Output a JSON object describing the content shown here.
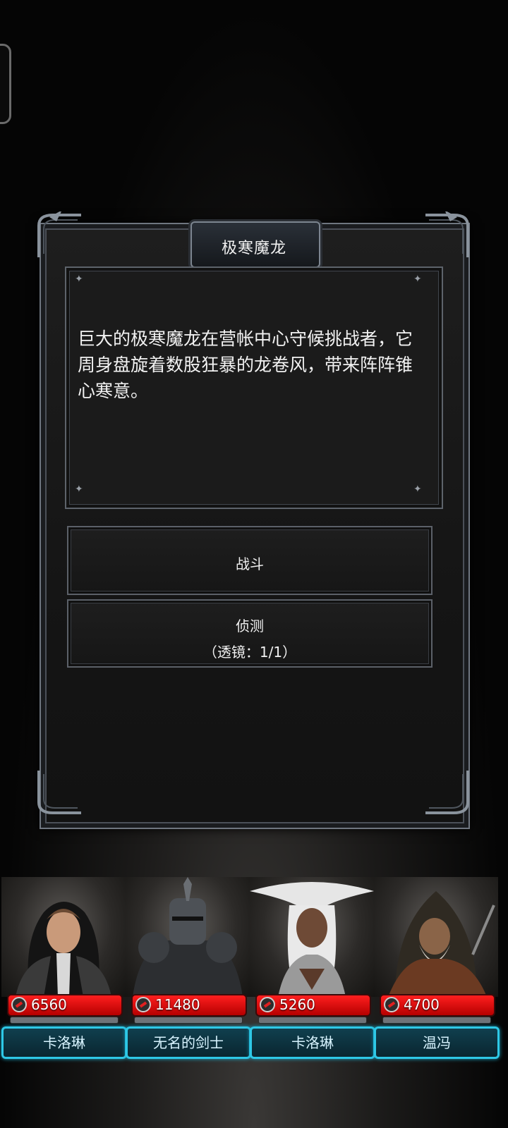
{
  "dialog": {
    "title": "极寒魔龙",
    "description": "巨大的极寒魔龙在营帐中心守候挑战者，它周身盘旋着数股狂暴的龙卷风，带来阵阵锥心寒意。",
    "fight_label": "战斗",
    "detect_label": "侦测",
    "detect_sub": "（透镜：1/1）"
  },
  "party": [
    {
      "name": "卡洛琳",
      "hp": "6560",
      "icon": "nun-portrait"
    },
    {
      "name": "无名的剑士",
      "hp": "11480",
      "icon": "knight-portrait"
    },
    {
      "name": "卡洛琳",
      "hp": "5260",
      "icon": "priestess-portrait"
    },
    {
      "name": "温冯",
      "hp": "4700",
      "icon": "hunter-portrait"
    }
  ],
  "colors": {
    "accent_cyan": "#2ec8e6",
    "hp_red": "#e01010",
    "frame_silver": "#7c8590"
  }
}
